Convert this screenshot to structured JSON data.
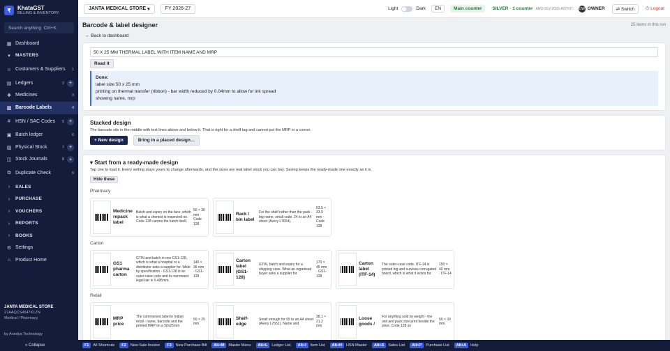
{
  "brand": {
    "name": "KhataGST",
    "subtitle": "BILLING & INVENTORY",
    "logo": "₹"
  },
  "search": {
    "placeholder": "Search anything",
    "shortcut": "Ctrl+K"
  },
  "nav": [
    {
      "label": "Dashboard",
      "icon": "dashboard-icon",
      "glyph": "▦"
    },
    {
      "label": "MASTERS",
      "section": true,
      "glyph": "▾"
    },
    {
      "label": "Customers & Suppliers",
      "count": "1",
      "icon": "users-icon",
      "glyph": "☺"
    },
    {
      "label": "Ledgers",
      "count": "2",
      "plus": true,
      "icon": "ledger-icon",
      "glyph": "▤"
    },
    {
      "label": "Medicines",
      "count": "3",
      "icon": "pill-icon",
      "glyph": "✚"
    },
    {
      "label": "Barcode Labels",
      "count": "4",
      "active": true,
      "icon": "barcode-icon",
      "glyph": "▥"
    },
    {
      "label": "HSN / SAC Codes",
      "count": "5",
      "plus": true,
      "icon": "tag-icon",
      "glyph": "#"
    },
    {
      "label": "Batch ledger",
      "count": "6",
      "icon": "batch-icon",
      "glyph": "▣"
    },
    {
      "label": "Physical Stock",
      "count": "7",
      "plus": true,
      "icon": "stock-icon",
      "glyph": "▨"
    },
    {
      "label": "Stock Journals",
      "count": "8",
      "plus": true,
      "icon": "journal-icon",
      "glyph": "◫"
    },
    {
      "label": "Duplicate Check",
      "count": "9",
      "icon": "duplicate-icon",
      "glyph": "⧉"
    },
    {
      "label": "SALES",
      "section": true,
      "glyph": "›"
    },
    {
      "label": "PURCHASE",
      "section": true,
      "glyph": "›"
    },
    {
      "label": "VOUCHERS",
      "section": true,
      "glyph": "›"
    },
    {
      "label": "REPORTS",
      "section": true,
      "glyph": "›"
    },
    {
      "label": "BOOKS",
      "section": true,
      "glyph": "›"
    },
    {
      "label": "Settings",
      "icon": "gear-icon",
      "glyph": "⚙"
    },
    {
      "label": "Product Home",
      "icon": "home-icon",
      "glyph": "⌂"
    }
  ],
  "company": {
    "name": "JANTA MEDICAL STORE",
    "gstin": "27AAQCS4547K1ZN",
    "type": "Medical / Pharmacy"
  },
  "byline": "by Anedya Technology",
  "collapse": "« Collapse",
  "topbar": {
    "store": "JANTA MEDICAL STORE",
    "fy": "FY 2026-27",
    "light": "Light",
    "dark": "Dark",
    "lang": "EN",
    "counter": "Main counter",
    "plan": "SILVER · 1 counter",
    "plan_code": "ANO-SLV-2026-A07F97",
    "owner_initials": "OW",
    "owner": "OWNER",
    "switch": "Switch",
    "logout": "Logout"
  },
  "page": {
    "title": "Barcode & label designer",
    "items_count": "25 items in this run",
    "back": "Back to dashboard"
  },
  "request": {
    "text": "50 X 25 MM THERMAL LABEL WITH ITEM NAME AND MRP",
    "button": "Read it",
    "done_title": "Done:",
    "done_lines": [
      "label size 50 x 25 mm",
      "printing on thermal transfer (ribbon) - bar width reduced by 0.04mm to allow for ink spread",
      "showing name, mrp"
    ]
  },
  "stacked": {
    "title": "Stacked design",
    "desc": "The barcode sits in the middle with text lines above and below it. That is right for a shelf tag and cannot put the MRP in a corner.",
    "new_btn": "+ New design",
    "placed_btn": "Bring in a placed design…"
  },
  "readymade": {
    "title": "Start from a ready-made design",
    "desc": "Tap one to load it. Every setting stays yours to change afterwards, and the sizes are real label stock you can buy. Saving keeps the ready-made one exactly as it is.",
    "hide": "Hide these",
    "categories": [
      {
        "name": "Pharmacy",
        "cards": [
          {
            "name": "Medicine repack label",
            "desc": "Batch and expiry on the face, which is what a chemist is inspected on. Code 128 carries the batch itself.",
            "size": "50 × 30 mm · Code 128"
          },
          {
            "name": "Rack / bin label",
            "desc": "For the shelf rather than the pack - big name, small code. 24 to an A4 sheet (Avery L7654).",
            "size": "63.5 × 33.9 mm · Code 128"
          }
        ]
      },
      {
        "name": "Carton",
        "cards": [
          {
            "name": "GS1 pharma carton",
            "desc": "GTIN and batch in one GS1-128, which is what a hospital or a distributor asks a supplier for. Wide by specification - GS1-128 is an outer-case code and its narrowest legal bar is 0.495mm.",
            "size": "140 × 36 mm · GS1-128"
          },
          {
            "name": "Carton label (GS1-128)",
            "desc": "GTIN, batch and expiry for a shipping case. What an organised buyer asks a supplier for.",
            "size": "170 × 45 mm · GS1-128"
          },
          {
            "name": "Carton label (ITF-14)",
            "desc": "The outer-case code. ITF-14 is printed big and survives corrugated board, which is what it exists for.",
            "size": "150 × 40 mm · ITF-14"
          }
        ]
      },
      {
        "name": "Retail",
        "cards": [
          {
            "name": "MRP price",
            "desc": "The commonest label in Indian retail - name, barcode and the printed MRP on a 50x25mm",
            "size": "50 × 25 mm"
          },
          {
            "name": "Shelf-edge",
            "desc": "Small enough for 65 to an A4 sheet (Avery L7651). Name and",
            "size": "38.1 × 21.2 mm"
          },
          {
            "name": "Loose goods /",
            "desc": "For anything sold by weight - the unit and pack size print beside the price. Code 128 so",
            "size": "50 × 30 mm"
          }
        ]
      }
    ]
  },
  "footer": [
    {
      "key": "F1",
      "label": "All Shortcuts"
    },
    {
      "key": "F2",
      "label": "New Sale Invoice"
    },
    {
      "key": "F3",
      "label": "New Purchase Bill"
    },
    {
      "key": "Alt+M",
      "label": "Master Menu"
    },
    {
      "key": "Alt+L",
      "label": "Ledger List"
    },
    {
      "key": "Alt+I",
      "label": "Item List"
    },
    {
      "key": "Alt+H",
      "label": "HSN Master"
    },
    {
      "key": "Alt+S",
      "label": "Sales List"
    },
    {
      "key": "Alt+P",
      "label": "Purchase List"
    },
    {
      "key": "Alt+A",
      "label": "Help"
    }
  ]
}
